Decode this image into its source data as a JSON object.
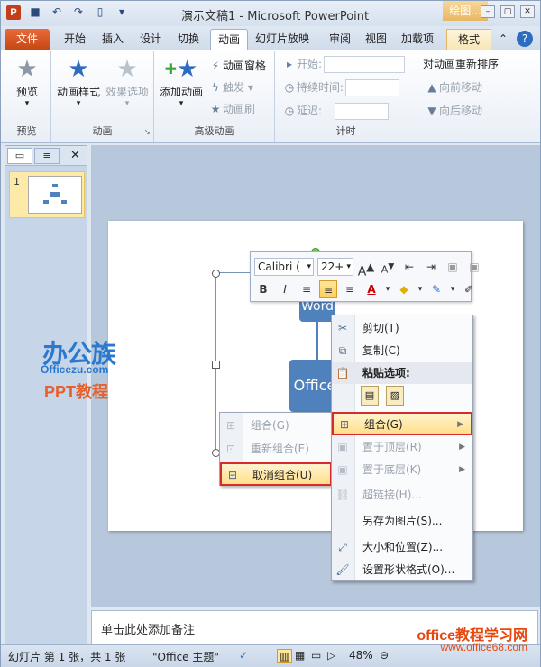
{
  "window": {
    "title": "演示文稿1 - Microsoft PowerPoint",
    "context_tab_title": "绘图..."
  },
  "tabs": [
    "文件",
    "开始",
    "插入",
    "设计",
    "切换",
    "动画",
    "幻灯片放映",
    "审阅",
    "视图",
    "加载项",
    "格式"
  ],
  "ribbon": {
    "preview_label": "预览",
    "group_preview": "预览",
    "anim_style_label": "动画样式",
    "effect_options_label": "效果选项",
    "group_animation": "动画",
    "add_animation_label": "添加动画",
    "anim_pane_label": "动画窗格",
    "trigger_label": "触发",
    "anim_painter_label": "动画刷",
    "group_advanced": "高级动画",
    "start_label": "开始:",
    "duration_label": "持续时间:",
    "delay_label": "延迟:",
    "group_timing": "计时",
    "reorder_title": "对动画重新排序",
    "move_earlier": "向前移动",
    "move_later": "向后移动"
  },
  "leftpane": {
    "thumb_num": "1"
  },
  "slide": {
    "top_box_text": "Word",
    "center_box_text": "Office"
  },
  "mini_toolbar": {
    "font": "Calibri (",
    "size": "22+"
  },
  "menu_main": {
    "cut": "剪切(T)",
    "copy": "复制(C)",
    "paste_options": "粘贴选项:",
    "group": "组合(G)",
    "bring_front": "置于顶层(R)",
    "send_back": "置于底层(K)",
    "hyperlink": "超链接(H)...",
    "save_picture": "另存为图片(S)...",
    "size_position": "大小和位置(Z)...",
    "format_shape": "设置形状格式(O)..."
  },
  "menu_sub": {
    "group": "组合(G)",
    "regroup": "重新组合(E)",
    "ungroup": "取消组合(U)"
  },
  "watermark": {
    "cn": "办公族",
    "en": "Officezu.com",
    "ppt": "PPT教程",
    "site_cn": "office教程学习网",
    "site_url": "www.office68.com"
  },
  "notes": {
    "placeholder": "单击此处添加备注"
  },
  "status": {
    "slide_info": "幻灯片 第 1 张，共 1 张",
    "theme": "\"Office 主题\"",
    "zoom": "48%"
  }
}
